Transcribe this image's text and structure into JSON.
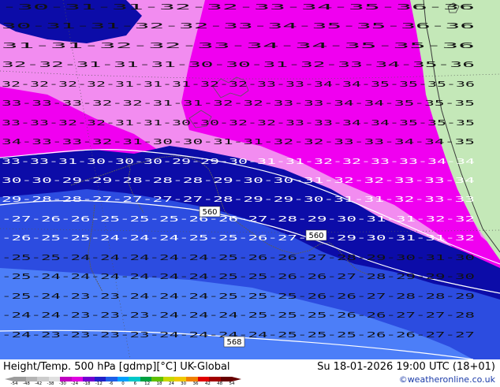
{
  "footer": {
    "title": "Height/Temp. 500 hPa [gdmp][°C] UK-Global",
    "datetime": "Su 18-01-2026 19:00 UTC (18+01)",
    "copyright": "©weatheronline.co.uk"
  },
  "colorscale": {
    "ticks": [
      "-54",
      "-48",
      "-42",
      "-38",
      "-30",
      "-24",
      "-18",
      "-12",
      "-6",
      "0",
      "6",
      "12",
      "18",
      "24",
      "30",
      "36",
      "42",
      "48",
      "54"
    ],
    "colors": [
      "#9c9c9c",
      "#b4b4b4",
      "#cccccc",
      "#e0e0e0",
      "#c000c0",
      "#e000e0",
      "#7000d0",
      "#2020c8",
      "#1e5ee8",
      "#00a0ff",
      "#00c8c8",
      "#00a040",
      "#60c000",
      "#c8d800",
      "#f0c800",
      "#f08000",
      "#e00000",
      "#a00000",
      "#660000"
    ]
  },
  "map": {
    "colors": {
      "land": "#c4e8b8",
      "magenta": "#f000f0",
      "pink": "#f28cf0",
      "dark_blue": "#0c0ca8",
      "mid_blue": "#2c4ce0",
      "light_blue": "#4c7ef8"
    },
    "height_labels": [
      "560",
      "560",
      "568"
    ],
    "temp_rows": [
      {
        "row": "-30-31-31-32-32-33-34-35-36-36",
        "color": "#111"
      },
      {
        "row": "30-31-31-32-32-33-34-35-35-36-36",
        "color": "#111"
      },
      {
        "row": "31-31-32-32-33-34-34-35-35-36",
        "color": "#111"
      },
      {
        "row": "32-32-31-31-31-30-30-31-32-33-34-35-36",
        "color": "#111"
      },
      {
        "row": "32-32-32-32-31-31-31-32-32-33-33-34-34-35-35-35-36",
        "color": "#111"
      },
      {
        "row": "33-33-33-32-32-31-31-32-32-33-33-34-34-35-35-35",
        "color": "#111"
      },
      {
        "row": "33-33-32-32-31-31-30-30-32-32-33-33-34-34-35-35-35",
        "color": "#111"
      },
      {
        "row": "34-33-33-32-31-30-30-31-31-32-32-33-33-34-34-35",
        "color": "#111"
      },
      {
        "row": "33-33-31-30-30-30-29-29-30-31-31-32-32-33-33-34-34",
        "color": "#fff"
      },
      {
        "row": "30-30-29-29-28-28-28-29-30-30-31-32-32-33-33-34",
        "color": "#fff"
      },
      {
        "row": "29-28-28-27-27-27-27-28-29-29-30-31-31-32-33-33",
        "color": "#fff"
      },
      {
        "row": "-27-26-26-25-25-25-26-26-27-28-29-30-31-31-32-32",
        "color": "#fff"
      },
      {
        "row": "-26-25-25-24-24-24-25-25-26-27-28-29-30-31-31-32",
        "color": "#fff"
      },
      {
        "row": "-25-25-24-24-24-24-24-25-26-26-27-28-29-30-31-30",
        "color": "#111"
      },
      {
        "row": "-25-24-24-24-24-24-24-25-25-26-26-27-28-29-29-30",
        "color": "#111"
      },
      {
        "row": "-25-24-23-23-24-24-24-25-25-25-26-26-27-28-28-29",
        "color": "#111"
      },
      {
        "row": "-24-24-23-23-23-24-24-24-25-25-25-26-26-27-27-28",
        "color": "#111"
      },
      {
        "row": "-24-23-23-23-23-24-24-24-24-25-25-25-26-26-27-27",
        "color": "#111"
      }
    ]
  }
}
